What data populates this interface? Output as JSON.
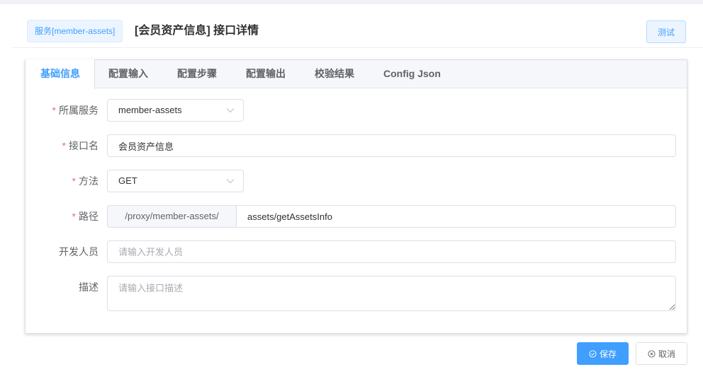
{
  "header": {
    "service_tag": "服务[member-assets]",
    "title": "[会员资产信息] 接口详情",
    "test_label": "测试"
  },
  "tabs": [
    {
      "label": "基础信息",
      "active": true
    },
    {
      "label": "配置输入",
      "active": false
    },
    {
      "label": "配置步骤",
      "active": false
    },
    {
      "label": "配置输出",
      "active": false
    },
    {
      "label": "校验结果",
      "active": false
    },
    {
      "label": "Config Json",
      "active": false
    }
  ],
  "form": {
    "service": {
      "required_mark": "*",
      "label": "所属服务",
      "value": "member-assets"
    },
    "name": {
      "required_mark": "*",
      "label": "接口名",
      "value": "会员资产信息"
    },
    "method": {
      "required_mark": "*",
      "label": "方法",
      "value": "GET"
    },
    "path": {
      "required_mark": "*",
      "label": "路径",
      "prefix": "/proxy/member-assets/",
      "value": "assets/getAssetsInfo"
    },
    "developer": {
      "label": "开发人员",
      "value": "",
      "placeholder": "请输入开发人员"
    },
    "description": {
      "label": "描述",
      "value": "",
      "placeholder": "请输入接口描述"
    }
  },
  "footer": {
    "save_label": "保存",
    "cancel_label": "取消"
  },
  "colors": {
    "primary": "#409eff",
    "required": "#f56c6c",
    "border": "#dcdfe6"
  },
  "icons": {
    "select_arrow": "chevron-down-icon",
    "save": "check-circle-icon",
    "cancel": "close-circle-icon"
  }
}
